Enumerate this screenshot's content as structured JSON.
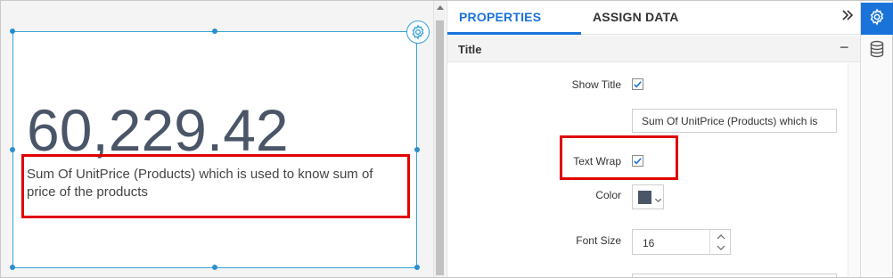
{
  "canvas": {
    "kpi_value": "60,229.42",
    "kpi_title": "Sum Of UnitPrice (Products) which is used to know sum of price of the products",
    "value_color": "#4a5568",
    "selection_color": "#39a3d8"
  },
  "panel": {
    "tabs": [
      {
        "label": "PROPERTIES",
        "active": true
      },
      {
        "label": "ASSIGN DATA",
        "active": false
      }
    ],
    "collapse_icon": "double-chevron-right",
    "section": {
      "title": "Title",
      "toggle": "−"
    },
    "properties": {
      "show_title": {
        "label": "Show Title",
        "checked": true
      },
      "title_text": {
        "value": "Sum Of UnitPrice (Products) which is"
      },
      "text_wrap": {
        "label": "Text Wrap",
        "checked": true
      },
      "color": {
        "label": "Color",
        "value": "#4a5568"
      },
      "font_size": {
        "label": "Font Size",
        "value": "16"
      }
    }
  },
  "rail": {
    "items": [
      {
        "icon": "gear-icon",
        "active": true
      },
      {
        "icon": "database-icon",
        "active": false
      }
    ]
  },
  "accent_color": "#1a73d9",
  "highlight_color": "#e00000"
}
